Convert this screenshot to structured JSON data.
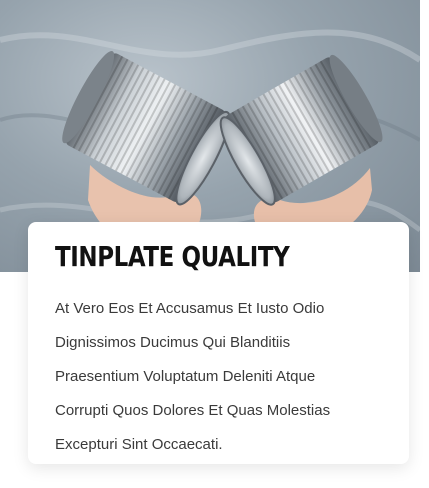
{
  "card": {
    "title": "TINPLATE QUALITY",
    "body_lines": [
      "At Vero Eos Et Accusamus Et Iusto Odio",
      "Dignissimos Ducimus Qui Blanditiis",
      "Praesentium Voluptatum Deleniti Atque",
      "Corrupti Quos Dolores Et Quas Molestias",
      "Excepturi Sint Occaecati."
    ]
  },
  "colors": {
    "title": "#111111",
    "body_text": "#3a3a3a",
    "card_background": "#ffffff",
    "hero_background": "#96a3ad"
  }
}
